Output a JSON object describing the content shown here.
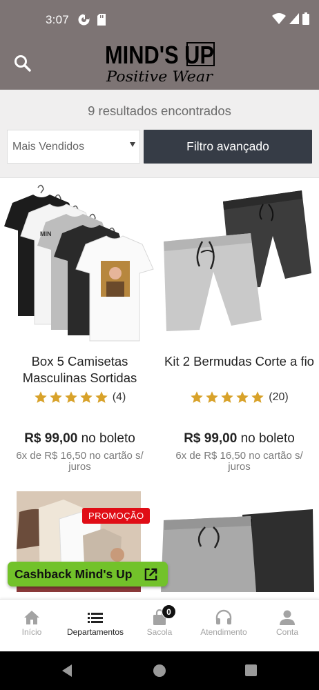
{
  "status_bar": {
    "time": "3:07"
  },
  "header": {
    "brand_line1": "MIND'S UP",
    "brand_line2": "Positive Wear"
  },
  "results": {
    "count_text": "9 resultados encontrados",
    "sort_selected": "Mais Vendidos",
    "filter_label": "Filtro avançado"
  },
  "products": [
    {
      "name": "Box 5 Camisetas Masculinas Sortidas",
      "rating": 5,
      "reviews": "(4)",
      "price": "R$ 99,00",
      "price_suffix": "no boleto",
      "installments": "6x de R$ 16,50 no cartão s/ juros"
    },
    {
      "name": "Kit 2 Bermudas Corte a fio",
      "rating": 5,
      "reviews": "(20)",
      "price": "R$ 99,00",
      "price_suffix": "no boleto",
      "installments": "6x de R$ 16,50 no cartão s/ juros"
    },
    {
      "badge": "PROMOÇÃO"
    },
    {}
  ],
  "cashback": {
    "label": "Cashback Mind's Up"
  },
  "tabs": [
    {
      "label": "Início",
      "icon": "home-icon"
    },
    {
      "label": "Departamentos",
      "icon": "list-icon"
    },
    {
      "label": "Sacola",
      "icon": "bag-icon",
      "badge": "0"
    },
    {
      "label": "Atendimento",
      "icon": "headset-icon"
    },
    {
      "label": "Conta",
      "icon": "person-icon"
    }
  ],
  "colors": {
    "header_bg": "#7d7474",
    "filter_button": "#363c46",
    "star": "#d8a22a",
    "promo_badge": "#e00d16",
    "cashback_button": "#72c22a"
  }
}
